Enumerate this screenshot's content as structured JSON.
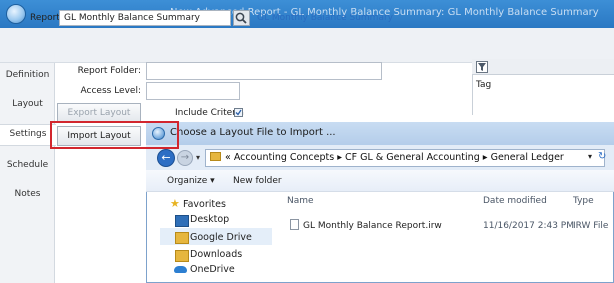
{
  "window": {
    "title": "New Advanced Report - GL Monthly Balance Summary: GL Monthly Balance Summary"
  },
  "report": {
    "label": "Report:",
    "value": "GL Monthly Balance Summary",
    "link": "GL Monthly Balance Summary"
  },
  "sidebar": {
    "items": [
      {
        "label": "Definition"
      },
      {
        "label": "Layout"
      },
      {
        "label": "Settings"
      },
      {
        "label": "Schedule"
      },
      {
        "label": "Notes"
      }
    ]
  },
  "form": {
    "report_folder_label": "Report Folder:",
    "report_folder_value": "",
    "access_level_label": "Access Level:",
    "access_level_value": "",
    "export_layout": "Export Layout",
    "import_layout": "Import Layout",
    "include_criteria_label": "Include Criteria",
    "include_criteria_checked": true
  },
  "tag_panel": {
    "column_header": "Tag"
  },
  "dialog": {
    "title": "Choose a Layout File to Import ...",
    "path": {
      "prefix": "«",
      "segments": [
        "Accounting Concepts",
        "CF GL & General Accounting",
        "General Ledger"
      ],
      "separator": "▸"
    },
    "toolbar": {
      "organize": "Organize ▾",
      "new_folder": "New folder"
    },
    "nav": {
      "favorites": "Favorites",
      "items": [
        "Desktop",
        "Google Drive",
        "Downloads",
        "OneDrive"
      ]
    },
    "columns": {
      "name": "Name",
      "date_modified": "Date modified",
      "type": "Type"
    },
    "files": [
      {
        "name": "GL Monthly Balance Report.irw",
        "date": "11/16/2017 2:43 PM",
        "type": "IRW File"
      }
    ]
  },
  "colors": {
    "titlebar": "#2a78c3",
    "highlight": "#d2262e",
    "link": "#2a6cc1"
  }
}
